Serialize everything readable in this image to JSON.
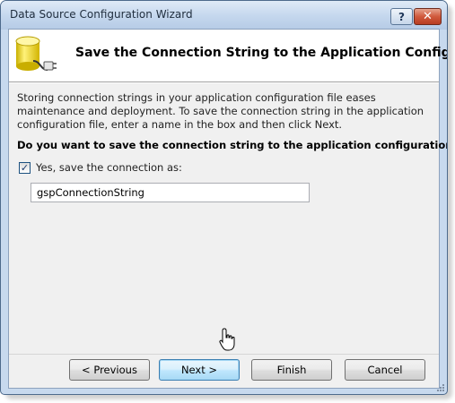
{
  "window": {
    "title": "Data Source Configuration Wizard",
    "help_label": "?",
    "close_label": "✕"
  },
  "header": {
    "title": "Save the Connection String to the Application Configuration File",
    "icon": "database-plug-icon"
  },
  "body": {
    "description": "Storing connection strings in your application configuration file eases maintenance and deployment. To save the connection string in the application configuration file, enter a name in the box and then click Next.",
    "question": "Do you want to save the connection string to the application configuration file?",
    "save_checkbox": {
      "label": "Yes, save the connection as:",
      "checked": true,
      "mark": "✓"
    },
    "connection_name": {
      "value": "gspConnectionString"
    }
  },
  "footer": {
    "previous_label": "< Previous",
    "next_label": "Next >",
    "finish_label": "Finish",
    "cancel_label": "Cancel"
  },
  "colors": {
    "frame": "#c7d9ee",
    "close_button": "#c8482c",
    "default_button_border": "#3c7fb1"
  }
}
